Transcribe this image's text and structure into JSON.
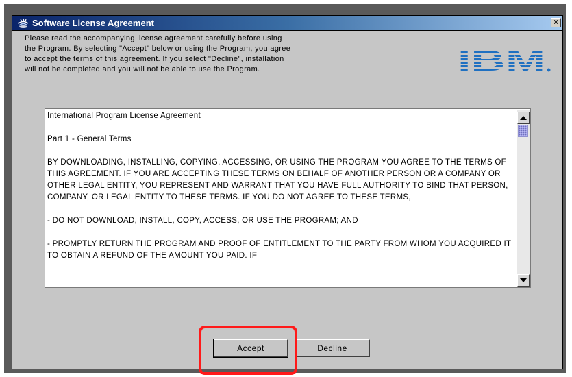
{
  "dialog": {
    "title": "Software License Agreement",
    "close_label": "×",
    "intro_lines": [
      "Please read the accompanying license agreement carefully before using",
      "the Program. By selecting \"Accept\" below or using the Program, you agree",
      "to accept the terms of this agreement. If you select \"Decline\", installation",
      "will not be completed and you will not be able to use the Program."
    ],
    "logo_text": "IBM"
  },
  "license": {
    "paragraphs": [
      "International Program License Agreement",
      "Part 1 - General Terms",
      "BY DOWNLOADING, INSTALLING, COPYING, ACCESSING, OR USING THE PROGRAM YOU AGREE TO THE TERMS OF THIS AGREEMENT. IF YOU ARE ACCEPTING THESE TERMS ON BEHALF OF ANOTHER PERSON OR A COMPANY OR OTHER LEGAL ENTITY, YOU REPRESENT AND WARRANT THAT YOU HAVE FULL AUTHORITY TO BIND THAT PERSON, COMPANY, OR LEGAL ENTITY TO THESE TERMS. IF YOU DO NOT AGREE TO THESE TERMS,",
      "- DO NOT DOWNLOAD, INSTALL, COPY, ACCESS, OR USE THE PROGRAM; AND",
      "- PROMPTLY RETURN THE PROGRAM AND PROOF OF ENTITLEMENT TO THE PARTY FROM WHOM YOU ACQUIRED IT TO OBTAIN A REFUND OF THE AMOUNT YOU PAID. IF"
    ]
  },
  "buttons": {
    "accept": "Accept",
    "decline": "Decline"
  },
  "colors": {
    "title_bar_start": "#0a246a",
    "title_bar_end": "#a6caf0",
    "ibm_blue": "#1f70c1",
    "highlight": "#ff1a1a"
  },
  "icons": {
    "title": "java-cup-icon",
    "close": "close-icon",
    "scroll_up": "arrow-up-icon",
    "scroll_down": "arrow-down-icon"
  }
}
